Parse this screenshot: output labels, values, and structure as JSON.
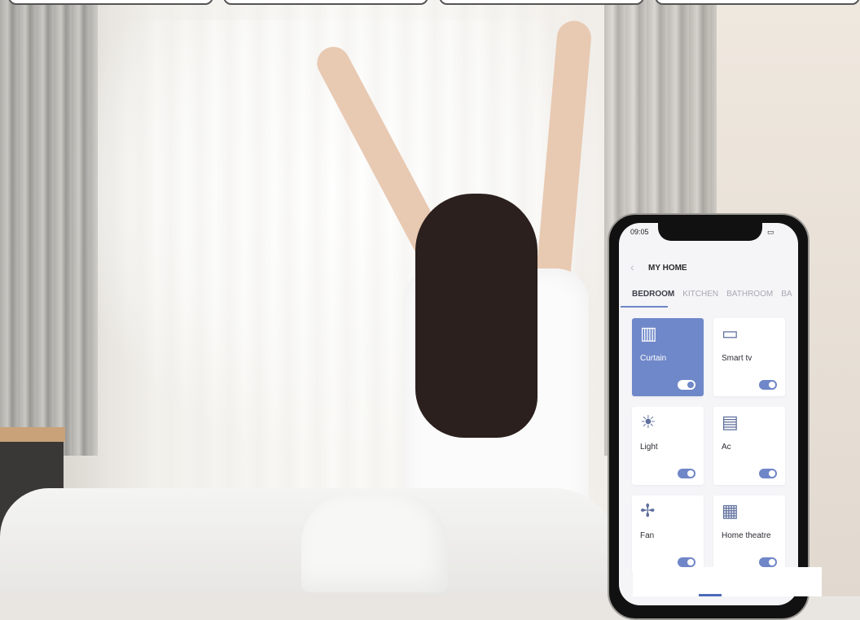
{
  "phone": {
    "time": "09:05",
    "title": "MY HOME",
    "tabs": [
      "BEDROOM",
      "KITCHEN",
      "BATHROOM",
      "BA"
    ],
    "active_tab_index": 0,
    "accent_color": "#6f88c9",
    "devices": [
      {
        "label": "Curtain",
        "icon": "curtain-icon",
        "on": true
      },
      {
        "label": "Smart tv",
        "icon": "tv-icon",
        "on": true
      },
      {
        "label": "Light",
        "icon": "bulb-icon",
        "on": true
      },
      {
        "label": "Ac",
        "icon": "ac-icon",
        "on": true
      },
      {
        "label": "Fan",
        "icon": "fan-icon",
        "on": true
      },
      {
        "label": "Home theatre",
        "icon": "speaker-icon",
        "on": true
      }
    ]
  }
}
